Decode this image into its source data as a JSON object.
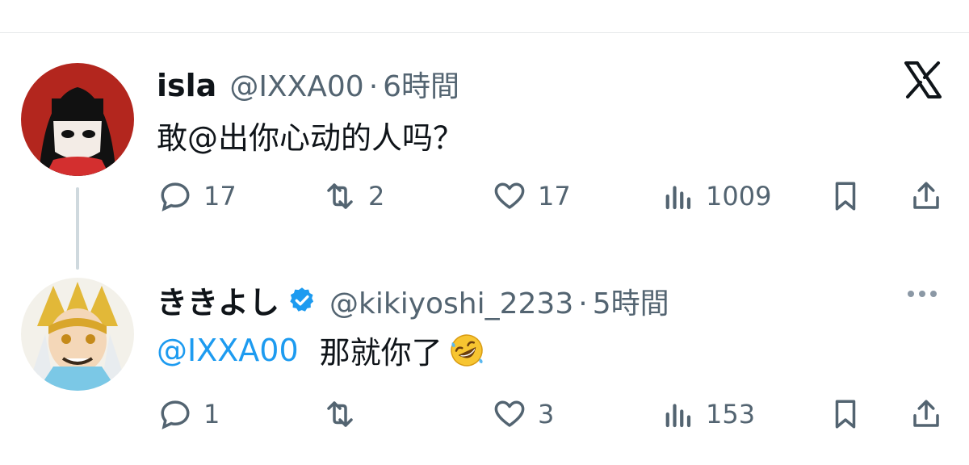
{
  "posts": [
    {
      "author_name": "isla",
      "handle": "@IXXA00",
      "separator": "·",
      "time": "6時間",
      "text": "敢@出你心动的人吗？",
      "actions": {
        "reply_count": "17",
        "repost_count": "2",
        "like_count": "17",
        "view_count": "1009"
      }
    },
    {
      "author_name": "ききよし",
      "verified": true,
      "handle": "@kikiyoshi_2233",
      "separator": "·",
      "time": "5時間",
      "mention": "@IXXA00",
      "text": "那就你了",
      "emoji": "rolling-on-floor-laughing",
      "actions": {
        "reply_count": "1",
        "repost_count": "",
        "like_count": "3",
        "view_count": "153"
      }
    }
  ],
  "colors": {
    "accent": "#1d9bf0",
    "text": "#0f1419",
    "muted": "#536471",
    "divider": "#e6e8ea"
  },
  "icons": [
    "reply-icon",
    "repost-icon",
    "like-icon",
    "views-icon",
    "bookmark-icon",
    "share-icon",
    "x-logo-icon",
    "more-icon",
    "verified-badge-icon"
  ]
}
